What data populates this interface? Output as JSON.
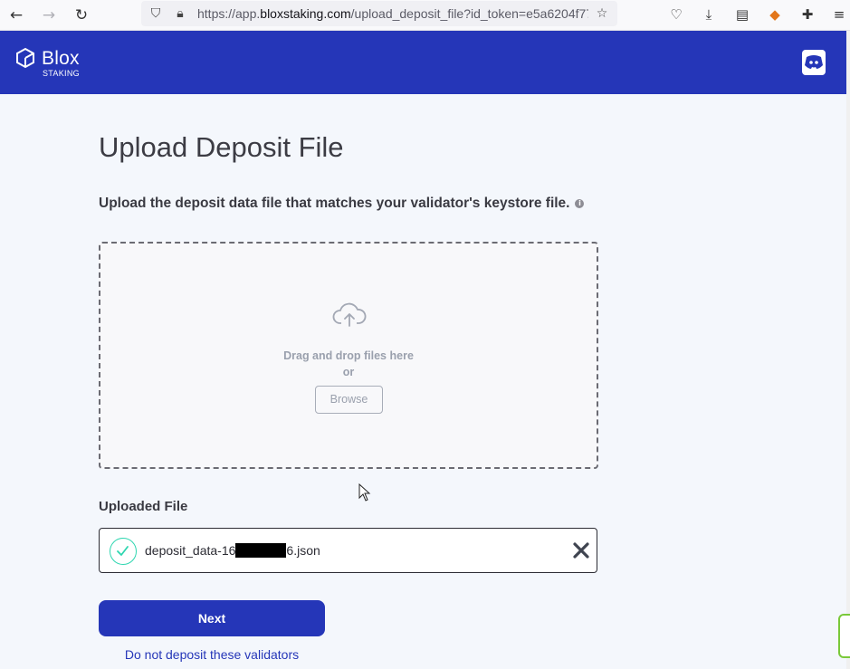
{
  "browser": {
    "url_prefix": "https://app.",
    "url_host": "bloxstaking.com",
    "url_path": "/upload_deposit_file?id_token=e5a6204f77"
  },
  "header": {
    "logo_name": "Blox",
    "logo_sub": "STAKING"
  },
  "main": {
    "title": "Upload Deposit File",
    "subtitle": "Upload the deposit data file that matches your validator's keystore file.",
    "dropzone": {
      "drag_text": "Drag and drop files here",
      "or_text": "or",
      "browse_label": "Browse"
    },
    "uploaded_label": "Uploaded File",
    "file": {
      "name_start": "deposit_data-16",
      "name_end": "6.json"
    },
    "next_label": "Next",
    "skip_link": "Do not deposit these validators"
  },
  "colors": {
    "brand": "#2536b8",
    "success": "#2ed6b0"
  }
}
